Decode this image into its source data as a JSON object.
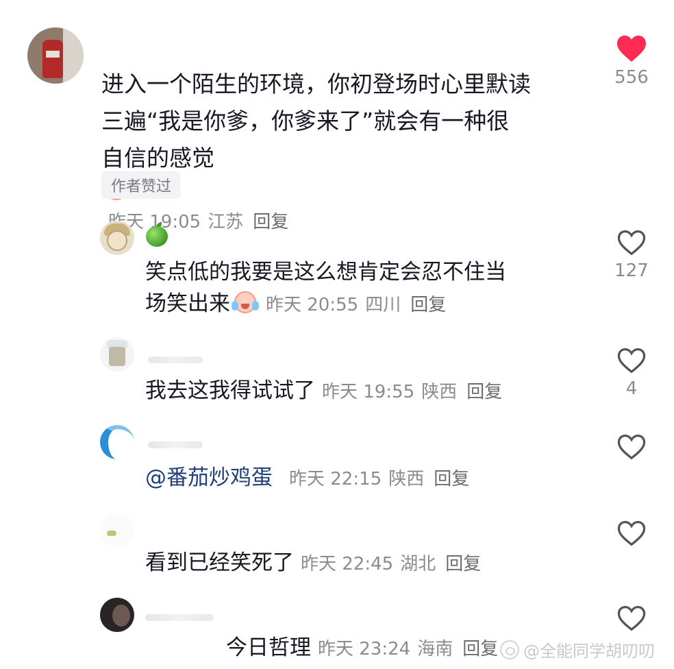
{
  "main_comment": {
    "text_lines": [
      "进入一个陌生的环境，你初登场时心里默读",
      "三遍“我是你爹，你爹来了”就会有一种很",
      "自信的感觉"
    ],
    "emoji": "crying-face-icon",
    "time": "昨天 19:05",
    "location": "江苏",
    "reply_label": "回复",
    "author_tag": "作者赞过",
    "likes": "556",
    "liked": true
  },
  "replies": [
    {
      "text_lines": [
        "笑点低的我要是这么想肯定会忍不住当",
        "场笑出来"
      ],
      "emoji": "crying-face-icon",
      "time": "昨天 20:55",
      "location": "四川",
      "reply_label": "回复",
      "likes": "127",
      "badge": "green-apple-icon"
    },
    {
      "text": "我去这我得试试了",
      "time": "昨天 19:55",
      "location": "陕西",
      "reply_label": "回复",
      "likes": "4"
    },
    {
      "mention": "@番茄炒鸡蛋",
      "time": "昨天 22:15",
      "location": "陕西",
      "reply_label": "回复",
      "likes": ""
    },
    {
      "text": "看到已经笑死了",
      "time": "昨天 22:45",
      "location": "湖北",
      "reply_label": "回复",
      "likes": ""
    },
    {
      "text": "今日哲理",
      "time": "昨天 23:24",
      "location": "海南",
      "reply_label": "回复",
      "likes": ""
    }
  ],
  "watermark": "@全能同学胡叨叨",
  "colors": {
    "like_active": "#fe2c55",
    "like_outline": "#555555",
    "meta_gray": "#8a8b91",
    "mention_blue": "#1f3f7a"
  }
}
